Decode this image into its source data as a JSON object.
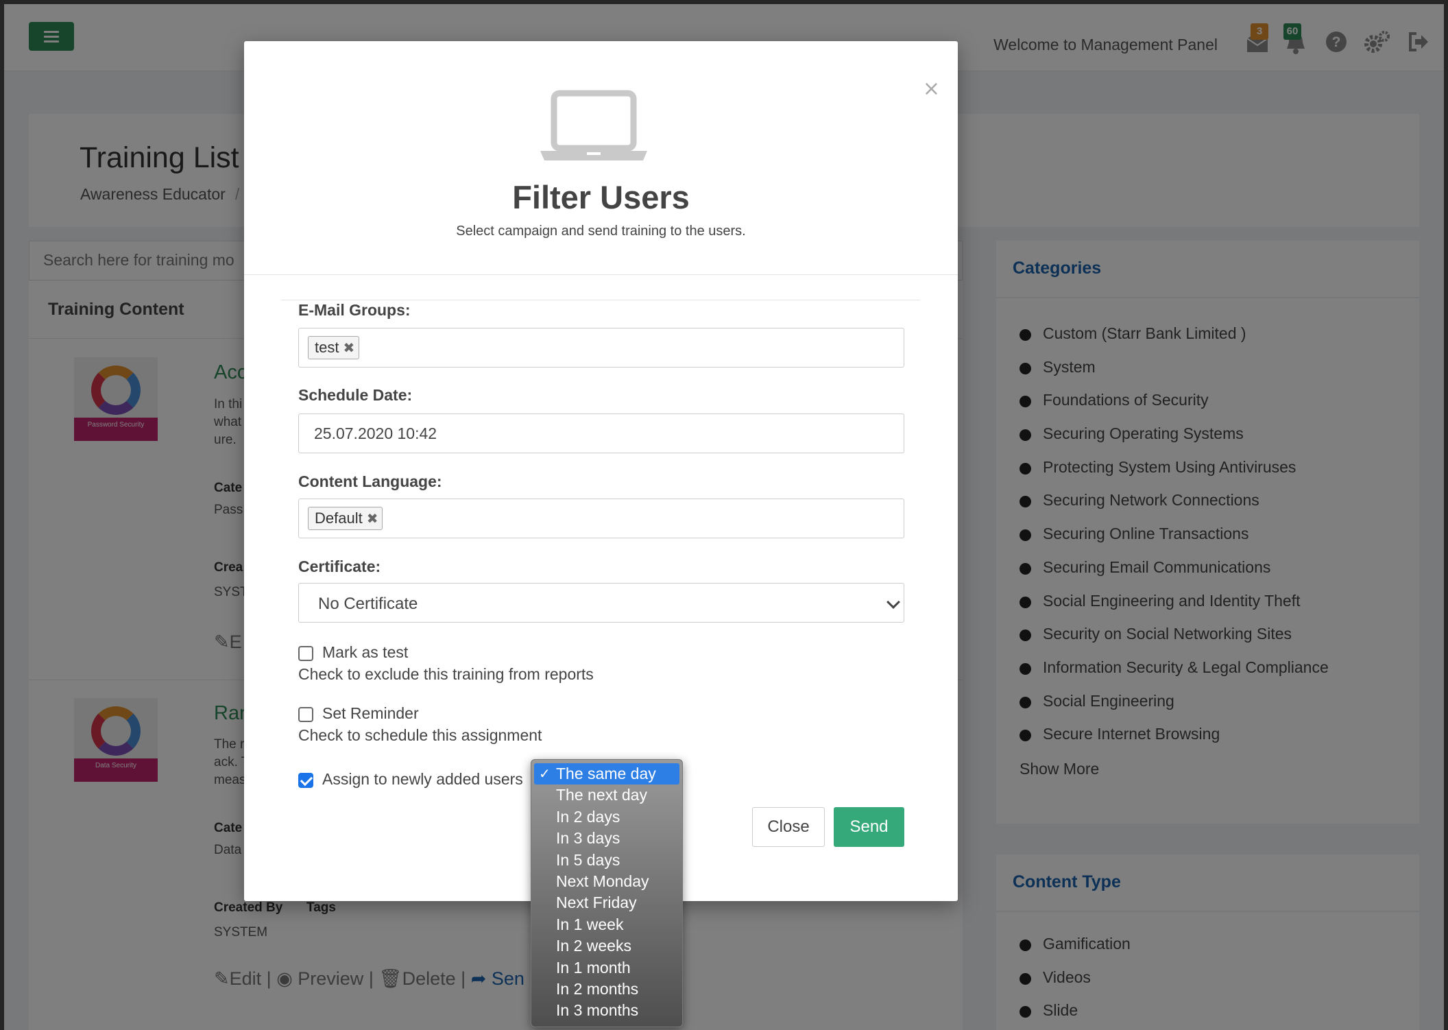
{
  "topbar": {
    "welcome": "Welcome to Management Panel",
    "mail_count": "3",
    "notification_count": "60",
    "icons": [
      "menu-icon",
      "mail-icon",
      "bell-icon",
      "help-icon",
      "gear-icon",
      "logout-icon"
    ]
  },
  "page": {
    "title": "Training List",
    "breadcrumb": "Awareness Educator",
    "breadcrumb_separator": "/"
  },
  "left": {
    "search_placeholder": "Search here for training mo",
    "section_title": "Training Content",
    "items": [
      {
        "thumb_caption": "Password Security",
        "title": "Acc",
        "desc": [
          "In thi",
          "what",
          "ure."
        ],
        "cat_label": "Cate",
        "cat_value": "Pass",
        "created_label": "Crea",
        "created_value": "SYST",
        "action_partial": "E"
      },
      {
        "thumb_caption": "Data Security",
        "title": "Ran",
        "desc": [
          "The r",
          "ack. T",
          "meas"
        ],
        "cat_label": "Cate",
        "cat_value": "Data",
        "created_label": "Created By",
        "tags_label": "Tags",
        "created_value": "SYSTEM",
        "action_edit": "Edit",
        "action_preview": "Preview",
        "action_delete": "Delete",
        "action_send": "Sen"
      }
    ]
  },
  "categories": {
    "title": "Categories",
    "items": [
      "Custom (Starr Bank Limited )",
      "System",
      "Foundations of Security",
      "Securing Operating Systems",
      "Protecting System Using Antiviruses",
      "Securing Network Connections",
      "Securing Online Transactions",
      "Securing Email Communications",
      "Social Engineering and Identity Theft",
      "Security on Social Networking Sites",
      "Information Security & Legal Compliance",
      "Social Engineering",
      "Secure Internet Browsing"
    ],
    "show_more": "Show More"
  },
  "content_type": {
    "title": "Content Type",
    "items": [
      "Gamification",
      "Videos",
      "Slide"
    ]
  },
  "modal": {
    "icon": "laptop-icon",
    "title": "Filter Users",
    "subtitle": "Select campaign and send training to the users.",
    "close_symbol": "×",
    "email_groups_label": "E-Mail Groups:",
    "email_group_tag": "test",
    "schedule_label": "Schedule Date:",
    "schedule_value": "25.07.2020 10:42",
    "language_label": "Content Language:",
    "language_tag": "Default",
    "certificate_label": "Certificate:",
    "certificate_value": "No Certificate",
    "mark_test_label": "Mark as test",
    "mark_test_hint": "Check to exclude this training from reports",
    "mark_test_checked": false,
    "reminder_label": "Set Reminder",
    "reminder_hint": "Check to schedule this assignment",
    "reminder_checked": false,
    "assign_label": "Assign to newly added users",
    "assign_checked": true,
    "close_button": "Close",
    "send_button": "Send"
  },
  "dropdown": {
    "selected": "The same day",
    "options": [
      "The same day",
      "The next day",
      "In 2 days",
      "In 3 days",
      "In 5 days",
      "Next Monday",
      "Next Friday",
      "In 1 week",
      "In 2 weeks",
      "In 1 month",
      "In 2 months",
      "In 3 months"
    ]
  },
  "colors": {
    "accent_green": "#36a97a",
    "link_blue": "#1a63ad",
    "mail_badge": "#e0912f",
    "notification_badge": "#2e8b57",
    "selection_blue": "#2e7fe5"
  }
}
